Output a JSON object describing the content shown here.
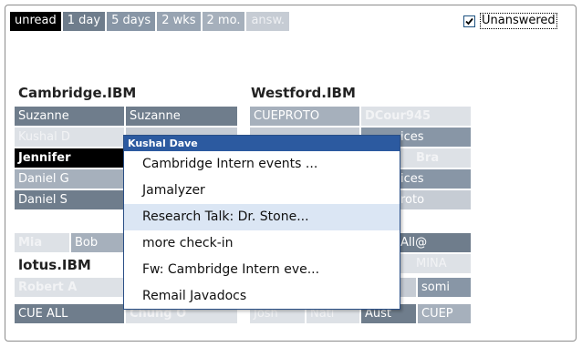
{
  "tabs": [
    {
      "label": "unread",
      "style": "active"
    },
    {
      "label": "1 day",
      "style": "t1"
    },
    {
      "label": "5 days",
      "style": "t2"
    },
    {
      "label": "2 wks",
      "style": "t3"
    },
    {
      "label": "2 mo.",
      "style": "t4"
    },
    {
      "label": "answ.",
      "style": "t5"
    }
  ],
  "unanswered": {
    "label": "Unanswered",
    "checked": true
  },
  "groups": {
    "cambridge": "Cambridge.IBM",
    "westford": "Westford.IBM",
    "lotus": "lotus.IBM"
  },
  "cells": {
    "suzanne1": "Suzanne",
    "suzanne2": "Suzanne",
    "cueproto": "CUEPROTO",
    "dcour": "DCour945",
    "kushal": "Kushal D",
    "ices1": "ices",
    "jennifer": "Jennifer",
    "bra": "Bra",
    "danielg": "Daniel G",
    "ices2": "ices",
    "daniels": "Daniel S",
    "roto": "roto",
    "mia": "Mia",
    "bob": "Bob",
    "all": "All@",
    "mina": "MINA",
    "roberta": "Robert A",
    "somi": "somi",
    "cueall": "CUE ALL",
    "chung": "Chung O",
    "josh": "Josh",
    "nati": "Nati",
    "aust": "Aust",
    "cuep": "CUEP"
  },
  "popup": {
    "title": "Kushal Dave",
    "items": [
      "Cambridge Intern events ...",
      "Jamalyzer",
      "Research Talk: Dr. Stone...",
      "more check-in",
      "Fw: Cambridge Intern eve...",
      "Remail Javadocs"
    ],
    "highlighted_index": 2
  },
  "colors": {
    "accent": "#2c5aa0",
    "dark_cell": "#6f7d8c",
    "mid_cell": "#8896a6",
    "light_cell": "#a6b0bc",
    "pale_cell": "#c6ccd4"
  }
}
